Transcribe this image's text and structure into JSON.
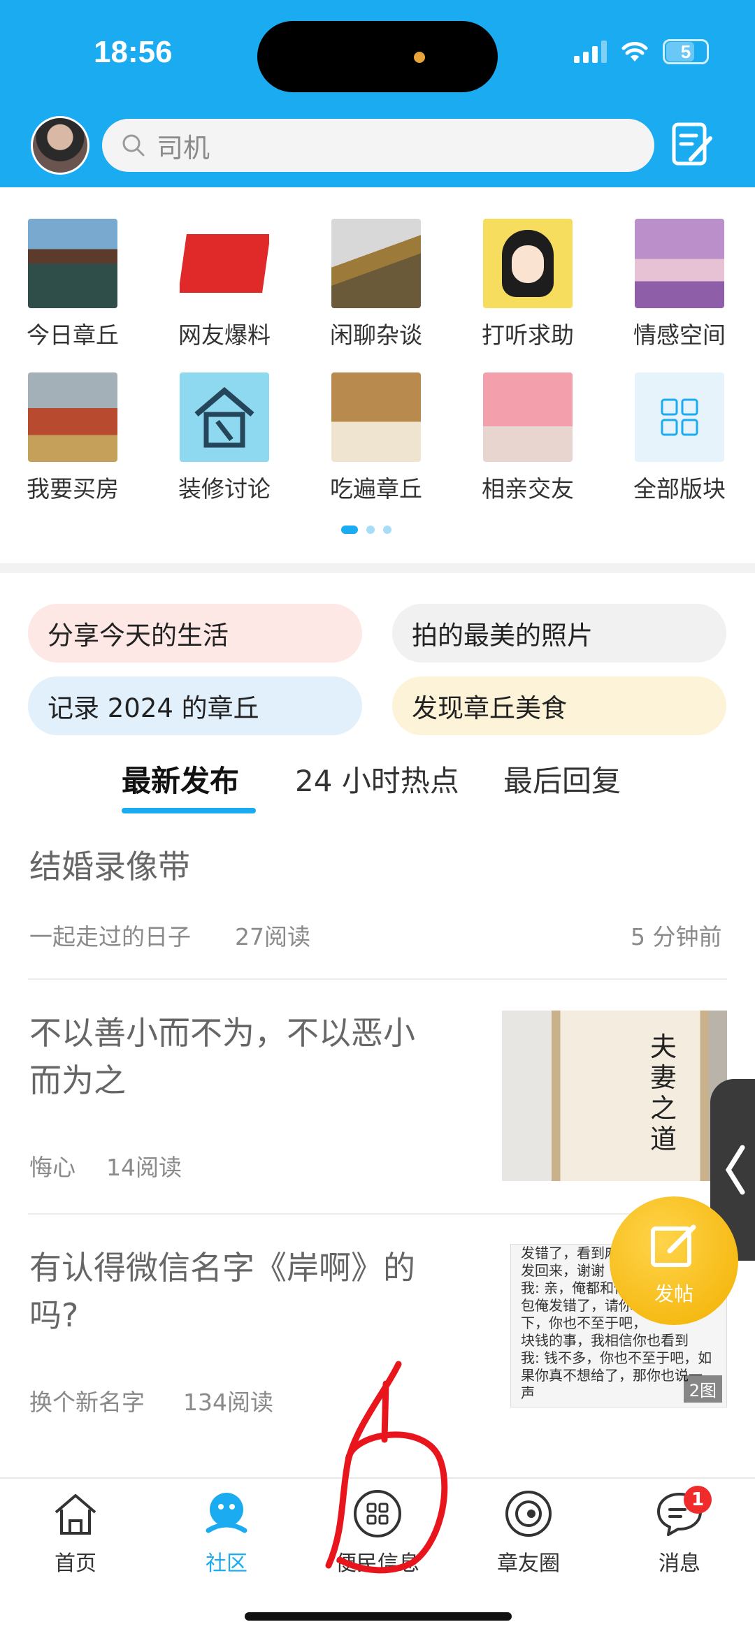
{
  "status_bar": {
    "time": "18:56",
    "battery": "5"
  },
  "search": {
    "placeholder": "司机"
  },
  "categories": [
    {
      "label": "今日章丘",
      "icon": "pavilion-lake-photo"
    },
    {
      "label": "网友爆料",
      "icon": "baoliao-logo"
    },
    {
      "label": "闲聊杂谈",
      "icon": "tea-pour-photo"
    },
    {
      "label": "打听求助",
      "icon": "cartoon-girl-avatar"
    },
    {
      "label": "情感空间",
      "icon": "book-heart-photo"
    },
    {
      "label": "我要买房",
      "icon": "house-coins-photo"
    },
    {
      "label": "装修讨论",
      "icon": "renovation-tools-icon"
    },
    {
      "label": "吃遍章丘",
      "icon": "girl-noodles-photo"
    },
    {
      "label": "相亲交友",
      "icon": "couple-photo"
    },
    {
      "label": "全部版块",
      "icon": "grid-icon"
    }
  ],
  "topics": [
    {
      "label": "分享今天的生活",
      "color": "#fde8e6"
    },
    {
      "label": "拍的最美的照片",
      "color": "#f1f1f1"
    },
    {
      "label": "记录 2024 的章丘",
      "color": "#e1f0fb"
    },
    {
      "label": "发现章丘美食",
      "color": "#fdf3d9"
    }
  ],
  "tabs": [
    {
      "label": "最新发布",
      "active": true
    },
    {
      "label": "24 小时热点",
      "active": false
    },
    {
      "label": "最后回复",
      "active": false
    }
  ],
  "posts": [
    {
      "title": "结婚录像带",
      "author": "一起走过的日子",
      "reads": "27阅读",
      "time": "5 分钟前"
    },
    {
      "title_line1": "不以善小而不为，不以恶小",
      "title_line2": "而为之",
      "author": "悔心",
      "reads": "14阅读",
      "thumb_text": [
        "夫",
        "妻",
        "之",
        "道"
      ]
    },
    {
      "title_line1": "有认得微信名字《岸啊》的",
      "title_line2": "吗?",
      "author": "换个新名字",
      "reads": "134阅读",
      "thumb_badge": "2图",
      "chat_lines": [
        "发错了，看到麻",
        "发回来，谢谢",
        "我: 亲，俺都和你",
        "包俺发错了，请你",
        "下，你也不至于吧，",
        "块钱的事，我相信你也看到",
        "我: 钱不多，你也不至于吧，如",
        "果你真不想给了，那你也说一",
        "声"
      ]
    }
  ],
  "fab": {
    "label": "发帖"
  },
  "bottom_nav": [
    {
      "label": "首页",
      "icon": "home-icon",
      "active": false
    },
    {
      "label": "社区",
      "icon": "community-icon",
      "active": true
    },
    {
      "label": "便民信息",
      "icon": "grid-info-icon",
      "active": false
    },
    {
      "label": "章友圈",
      "icon": "planet-icon",
      "active": false
    },
    {
      "label": "消息",
      "icon": "message-icon",
      "active": false,
      "badge": "1"
    }
  ],
  "colors": {
    "accent": "#1aabf0",
    "badge": "#ef2b2b",
    "fab": "#f2b000",
    "annotation": "#e8161c"
  }
}
